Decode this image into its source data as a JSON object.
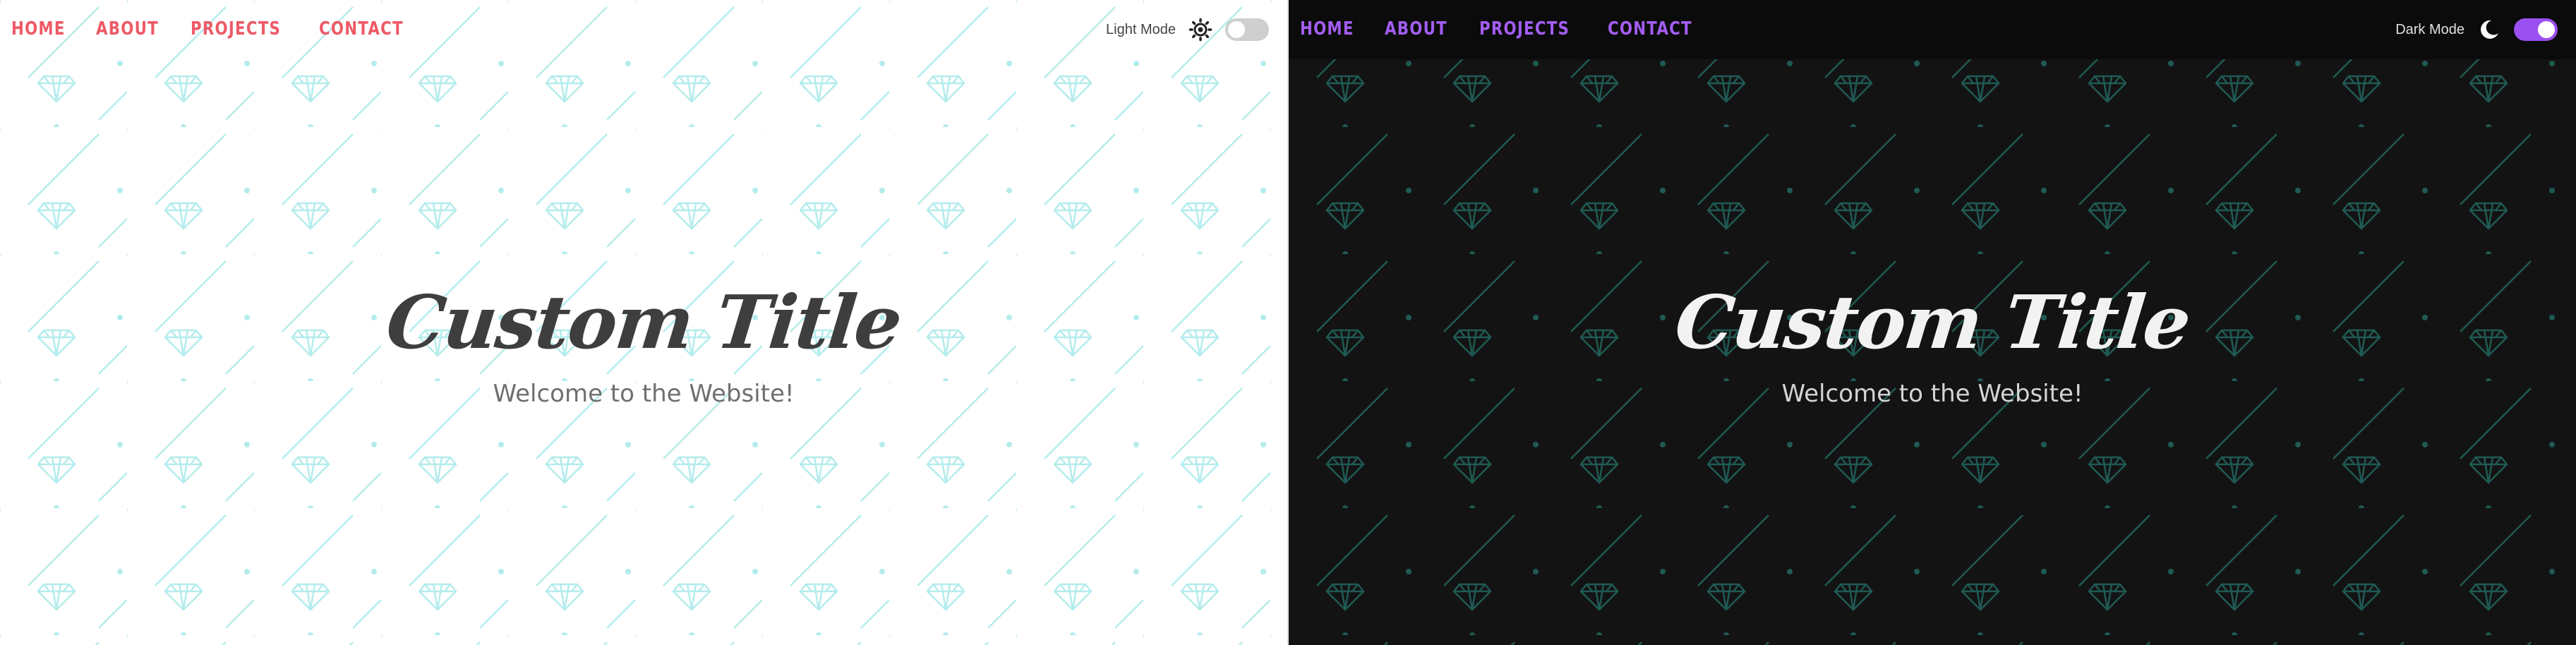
{
  "light": {
    "nav": {
      "items": [
        "HOME",
        "ABOUT",
        "PROJECTS",
        "CONTACT"
      ]
    },
    "mode_label": "Light Mode",
    "mode_icon": "sun-icon",
    "toggle_on": false,
    "hero": {
      "title": "Custom Title",
      "subtitle": "Welcome to the Website!"
    },
    "colors": {
      "background": "#ffffff",
      "nav": "#ee5a67",
      "pattern": "#a8e6e6",
      "title": "#3e3e3e"
    }
  },
  "dark": {
    "nav": {
      "items": [
        "HOME",
        "ABOUT",
        "PROJECTS",
        "CONTACT"
      ]
    },
    "mode_label": "Dark Mode",
    "mode_icon": "moon-icon",
    "toggle_on": true,
    "hero": {
      "title": "Custom Title",
      "subtitle": "Welcome to the Website!"
    },
    "colors": {
      "background": "#131313",
      "nav": "#a45df2",
      "pattern": "#1f5a54",
      "title": "#f2f2f2"
    }
  }
}
